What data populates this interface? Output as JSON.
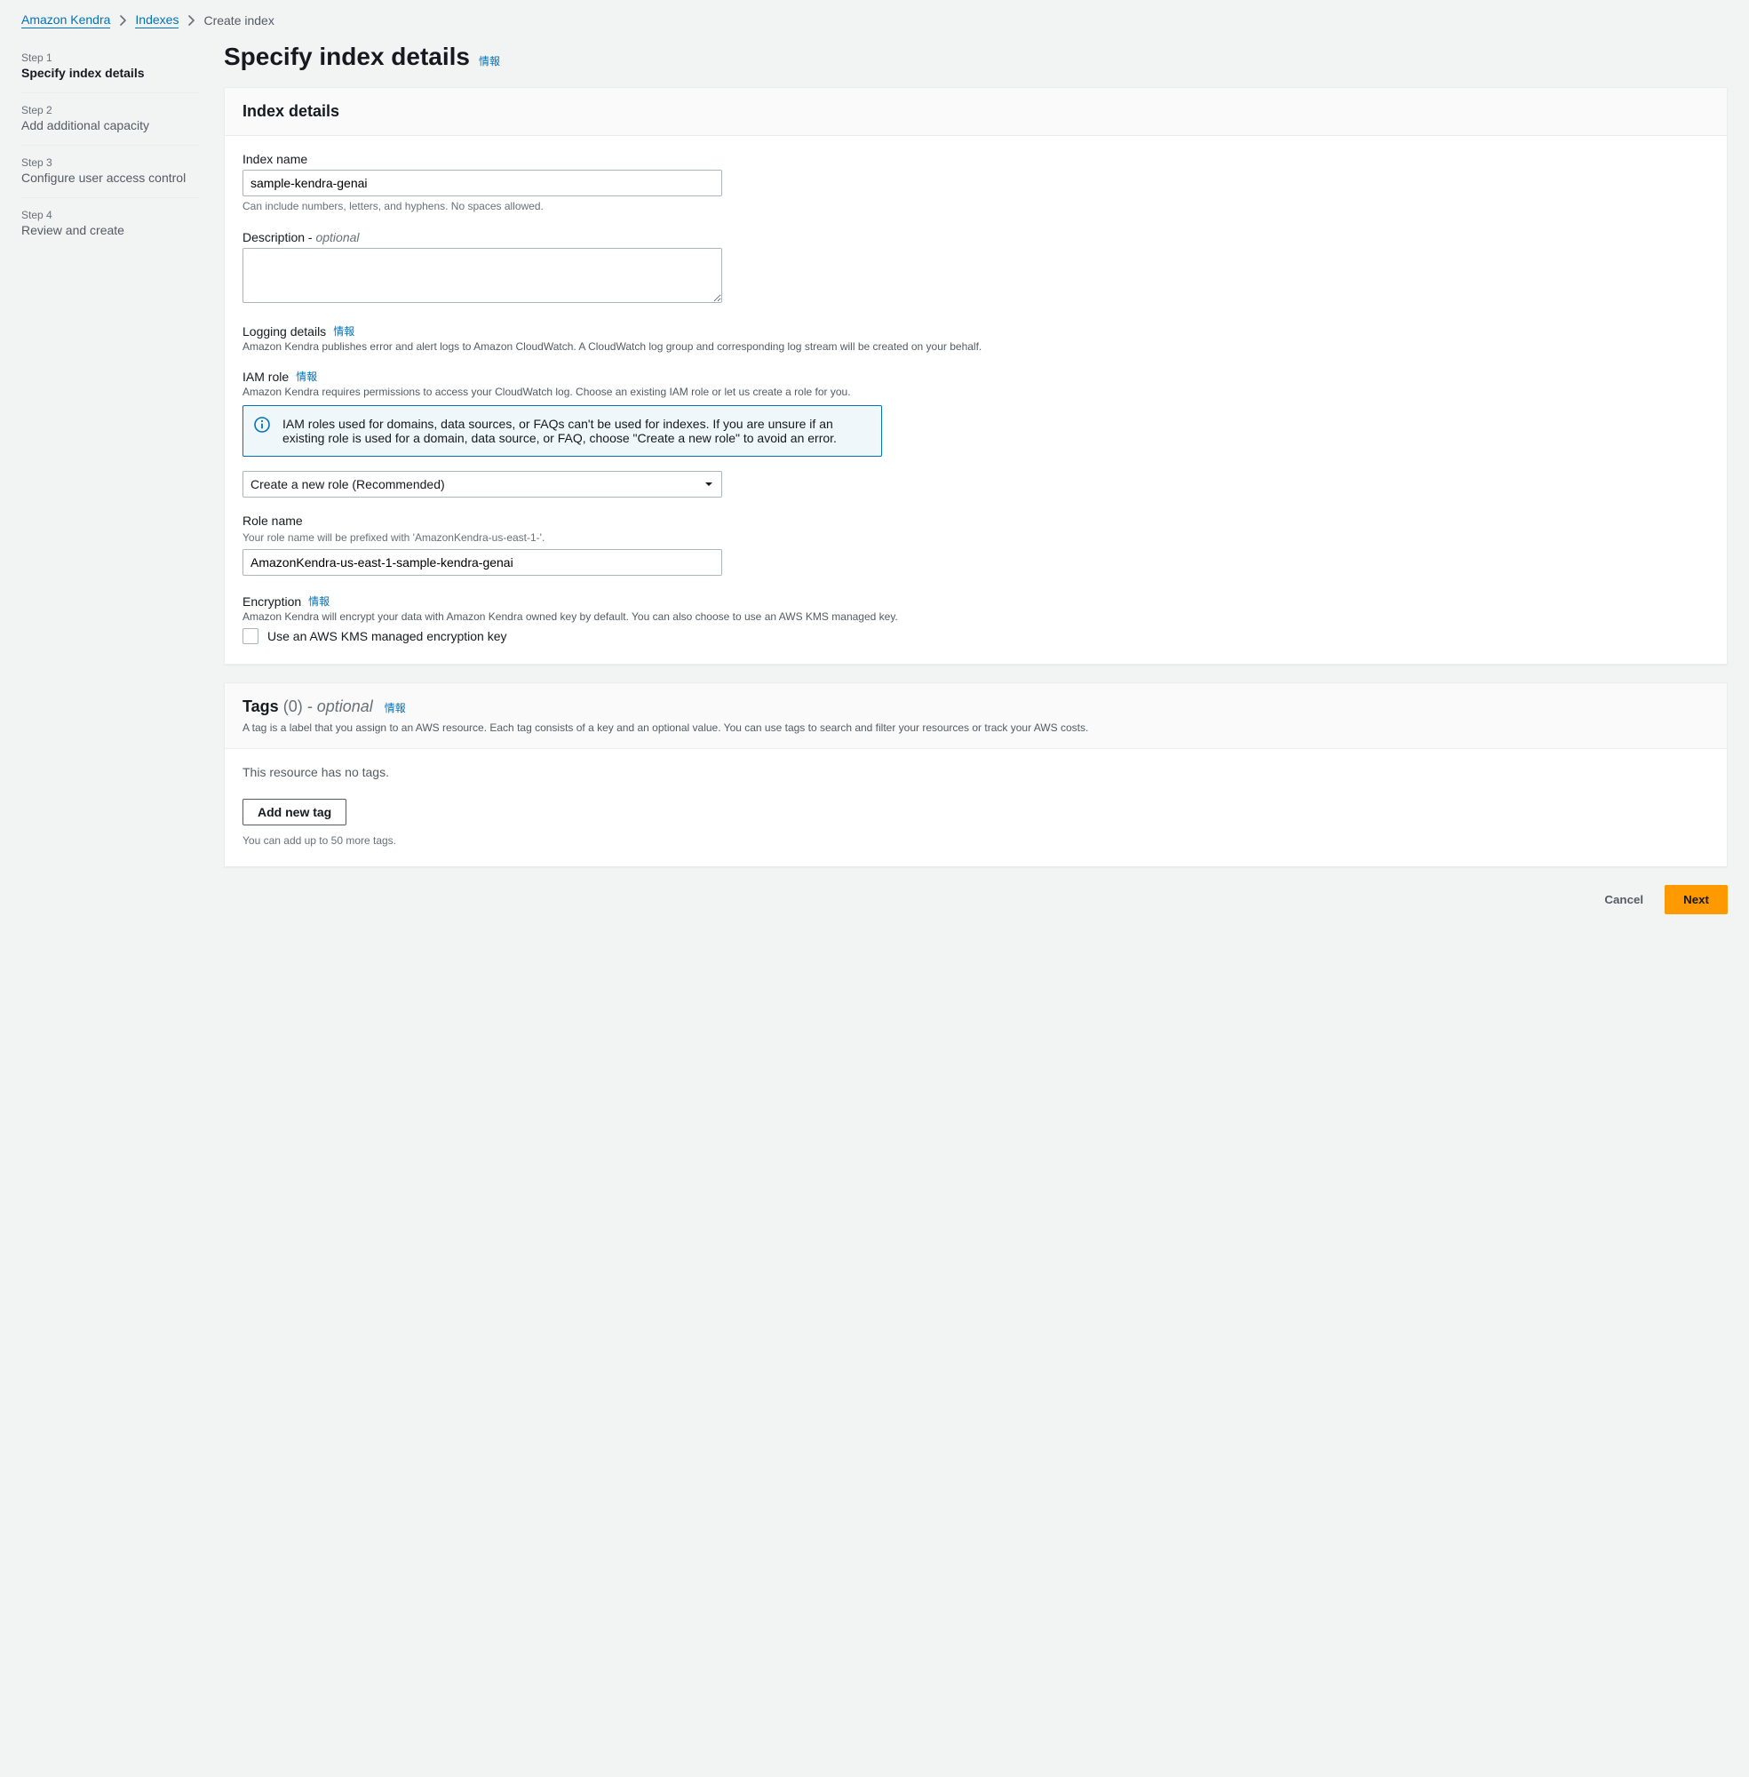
{
  "breadcrumb": {
    "root": "Amazon Kendra",
    "indexes": "Indexes",
    "current": "Create index"
  },
  "wizard": {
    "steps": [
      {
        "num": "Step 1",
        "label": "Specify index details"
      },
      {
        "num": "Step 2",
        "label": "Add additional capacity"
      },
      {
        "num": "Step 3",
        "label": "Configure user access control"
      },
      {
        "num": "Step 4",
        "label": "Review and create"
      }
    ]
  },
  "page": {
    "title": "Specify index details",
    "info": "情報"
  },
  "panel_index": {
    "title": "Index details",
    "index_name_label": "Index name",
    "index_name_value": "sample-kendra-genai",
    "index_name_hint": "Can include numbers, letters, and hyphens. No spaces allowed.",
    "description_label": "Description - ",
    "description_optional": "optional",
    "description_value": "",
    "logging_label": "Logging details",
    "logging_info": "情報",
    "logging_desc": "Amazon Kendra publishes error and alert logs to Amazon CloudWatch. A CloudWatch log group and corresponding log stream will be created on your behalf.",
    "iam_label": "IAM role",
    "iam_info": "情報",
    "iam_desc": "Amazon Kendra requires permissions to access your CloudWatch log. Choose an existing IAM role or let us create a role for you.",
    "iam_alert": "IAM roles used for domains, data sources, or FAQs can't be used for indexes. If you are unsure if an existing role is used for a domain, data source, or FAQ, choose \"Create a new role\" to avoid an error.",
    "iam_select": "Create a new role (Recommended)",
    "role_name_label": "Role name",
    "role_name_hint": "Your role name will be prefixed with 'AmazonKendra-us-east-1-'.",
    "role_name_value": "AmazonKendra-us-east-1-sample-kendra-genai",
    "encryption_label": "Encryption",
    "encryption_info": "情報",
    "encryption_desc": "Amazon Kendra will encrypt your data with Amazon Kendra owned key by default. You can also choose to use an AWS KMS managed key.",
    "encryption_chk": "Use an AWS KMS managed encryption key"
  },
  "panel_tags": {
    "title": "Tags",
    "count": "(0)",
    "sep": " - ",
    "optional": "optional",
    "info": "情報",
    "desc": "A tag is a label that you assign to an AWS resource. Each tag consists of a key and an optional value. You can use tags to search and filter your resources or track your AWS costs.",
    "no_tags": "This resource has no tags.",
    "add_button": "Add new tag",
    "hint": "You can add up to 50 more tags."
  },
  "footer": {
    "cancel": "Cancel",
    "next": "Next"
  }
}
